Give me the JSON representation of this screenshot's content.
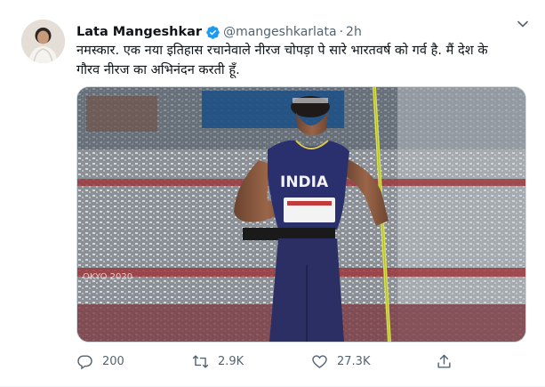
{
  "tweet": {
    "author_name": "Lata Mangeshkar",
    "handle": "@mangeshkarlata",
    "separator": "·",
    "time": "2h",
    "text_line1": "नमस्कार. एक नया इतिहास रचानेवाले नीरज चोपड़ा पे सारे भारतवर्ष को गर्व है. मैं देश के",
    "text_line2": "गौरव नीरज का अभिनंदन करती हूँ.",
    "image": {
      "jersey_text": "INDIA",
      "banner_text": "OKYO 2020"
    }
  },
  "actions": {
    "reply": {
      "icon": "reply-icon",
      "count": "200"
    },
    "retweet": {
      "icon": "retweet-icon",
      "count": "2.9K"
    },
    "like": {
      "icon": "heart-icon",
      "count": "27.3K"
    },
    "share": {
      "icon": "share-icon"
    }
  },
  "colors": {
    "text": "#0f1419",
    "secondary": "#536471",
    "verified": "#1d9bf0"
  }
}
